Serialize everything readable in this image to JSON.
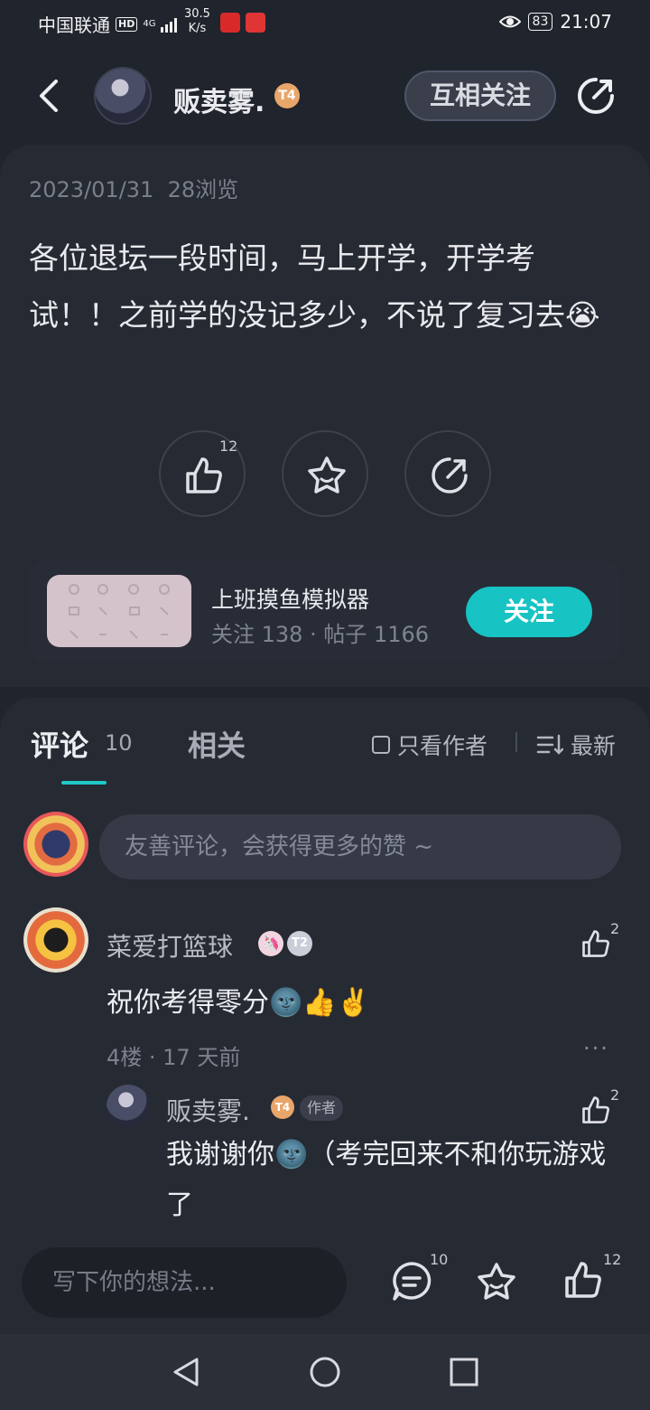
{
  "status_bar": {
    "carrier": "中国联通",
    "hd": "HD",
    "signal": "4G",
    "speed_value": "30.5",
    "speed_unit": "K/s",
    "battery": "83",
    "time": "21:07"
  },
  "header": {
    "author_name": "贩卖雾.",
    "author_level": "T4",
    "mutual_follow_label": "互相关注"
  },
  "post": {
    "date": "2023/01/31",
    "views": "28浏览",
    "body": "各位退坛一段时间，马上开学，开学考试！！之前学的没记多少，不说了复习去😭",
    "like_count": "12"
  },
  "community": {
    "name": "上班摸鱼模拟器",
    "stats": "关注 138 · 帖子 1166",
    "follow_label": "关注"
  },
  "comments_tabs": {
    "comments_label": "评论",
    "comments_count": "10",
    "related_label": "相关",
    "only_author_label": "只看作者",
    "sort_label": "最新"
  },
  "comment_input": {
    "placeholder": "友善评论，会获得更多的赞 ~"
  },
  "comments": [
    {
      "user": "菜爱打篮球",
      "level": "T2",
      "text": "祝你考得零分🌚👍✌️",
      "likes": "2",
      "meta": "4楼 · 17 天前",
      "more": "···",
      "reply": {
        "user": "贩卖雾.",
        "level": "T4",
        "author_tag": "作者",
        "text": "我谢谢你🌚（考完回来不和你玩游戏了",
        "likes": "2"
      }
    }
  ],
  "bottom_bar": {
    "placeholder": "写下你的想法...",
    "comment_count": "10",
    "like_count": "12"
  },
  "colors": {
    "background": "#20242d",
    "card": "#262a33",
    "accent": "#17c3c3",
    "level_badge": "#e8a66b"
  }
}
